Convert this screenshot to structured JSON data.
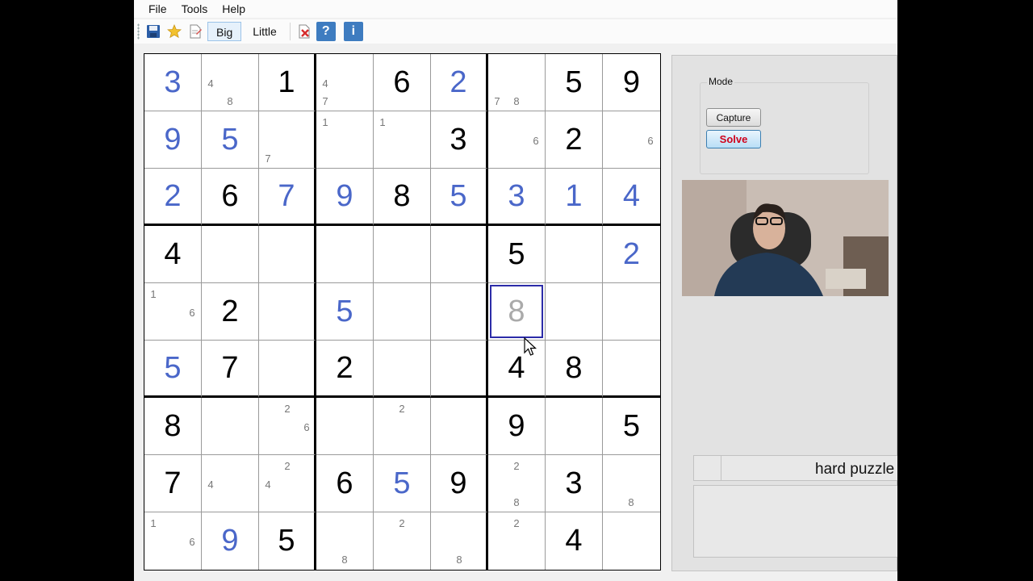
{
  "menu": [
    "File",
    "Tools",
    "Help"
  ],
  "toolbar": {
    "icons": [
      "save-icon",
      "star-icon",
      "document-icon"
    ],
    "big_label": "Big",
    "little_label": "Little",
    "clear_icon": "clear-icon",
    "help_label": "?",
    "info_label": "i"
  },
  "board": {
    "cells": [
      [
        {
          "v": "3",
          "t": "solved"
        },
        {
          "c": [
            4,
            8
          ]
        },
        {
          "v": "1",
          "t": "given"
        },
        {
          "c": [
            4,
            7
          ]
        },
        {
          "v": "6",
          "t": "given"
        },
        {
          "v": "2",
          "t": "solved"
        },
        {
          "c": [
            7,
            8
          ]
        },
        {
          "v": "5",
          "t": "given"
        },
        {
          "v": "9",
          "t": "given"
        }
      ],
      [
        {
          "v": "9",
          "t": "solved"
        },
        {
          "v": "5",
          "t": "solved"
        },
        {
          "c": [
            7
          ]
        },
        {
          "c": [
            1
          ]
        },
        {
          "c": [
            1
          ]
        },
        {
          "v": "3",
          "t": "given"
        },
        {
          "c": [
            6
          ]
        },
        {
          "v": "2",
          "t": "given"
        },
        {
          "c": [
            6
          ]
        }
      ],
      [
        {
          "v": "2",
          "t": "solved"
        },
        {
          "v": "6",
          "t": "given"
        },
        {
          "v": "7",
          "t": "solved"
        },
        {
          "v": "9",
          "t": "solved"
        },
        {
          "v": "8",
          "t": "given"
        },
        {
          "v": "5",
          "t": "solved"
        },
        {
          "v": "3",
          "t": "solved"
        },
        {
          "v": "1",
          "t": "solved"
        },
        {
          "v": "4",
          "t": "solved"
        }
      ],
      [
        {
          "v": "4",
          "t": "given"
        },
        {},
        {},
        {},
        {},
        {},
        {
          "v": "5",
          "t": "given"
        },
        {},
        {
          "v": "2",
          "t": "solved"
        }
      ],
      [
        {
          "c": [
            1,
            6
          ]
        },
        {
          "v": "2",
          "t": "given"
        },
        {},
        {
          "v": "5",
          "t": "solved"
        },
        {},
        {},
        {
          "v": "8",
          "t": "hint",
          "sel": true
        },
        {},
        {}
      ],
      [
        {
          "v": "5",
          "t": "solved"
        },
        {
          "v": "7",
          "t": "given"
        },
        {},
        {
          "v": "2",
          "t": "given"
        },
        {},
        {},
        {
          "v": "4",
          "t": "given"
        },
        {
          "v": "8",
          "t": "given"
        },
        {}
      ],
      [
        {
          "v": "8",
          "t": "given"
        },
        {},
        {
          "c": [
            2,
            6
          ]
        },
        {},
        {
          "c": [
            2
          ]
        },
        {},
        {
          "v": "9",
          "t": "given"
        },
        {},
        {
          "v": "5",
          "t": "given"
        }
      ],
      [
        {
          "v": "7",
          "t": "given"
        },
        {
          "c": [
            4
          ]
        },
        {
          "c": [
            2,
            4
          ]
        },
        {
          "v": "6",
          "t": "given"
        },
        {
          "v": "5",
          "t": "solved"
        },
        {
          "v": "9",
          "t": "given"
        },
        {
          "c": [
            2,
            8
          ]
        },
        {
          "v": "3",
          "t": "given"
        },
        {
          "c": [
            8
          ]
        }
      ],
      [
        {
          "c": [
            1,
            6
          ]
        },
        {
          "v": "9",
          "t": "solved"
        },
        {
          "v": "5",
          "t": "given"
        },
        {
          "c": [
            8
          ]
        },
        {
          "c": [
            2
          ]
        },
        {
          "c": [
            8
          ]
        },
        {
          "c": [
            2
          ]
        },
        {
          "v": "4",
          "t": "given"
        },
        {}
      ]
    ]
  },
  "panel": {
    "mode_label": "Mode",
    "capture_label": "Capture",
    "solve_label": "Solve",
    "status_text": "hard puzzle"
  },
  "colors": {
    "given": "#000000",
    "solved": "#4a67c9",
    "hint": "#aaaaaa",
    "selection": "#2c2ca8",
    "solve_text": "#d0021b"
  }
}
